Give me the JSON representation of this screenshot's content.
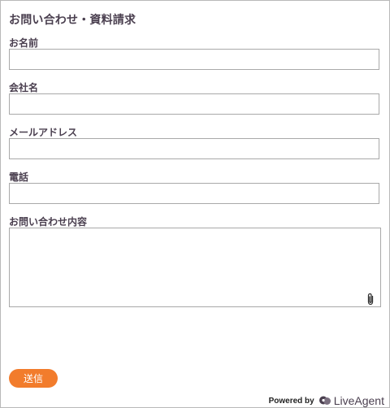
{
  "form": {
    "title": "お問い合わせ・資料請求",
    "fields": [
      {
        "label": "お名前",
        "value": ""
      },
      {
        "label": "会社名",
        "value": ""
      },
      {
        "label": "メールアドレス",
        "value": ""
      },
      {
        "label": "電話",
        "value": ""
      }
    ],
    "message": {
      "label": "お問い合わせ内容",
      "value": ""
    },
    "attach_icon": "paperclip-icon",
    "submit_label": "送信"
  },
  "footer": {
    "powered_by": "Powered by",
    "brand": "LiveAgent",
    "brand_icon": "liveagent-logo-icon"
  },
  "colors": {
    "text": "#4a3f4f",
    "accent": "#f27c2c",
    "border": "#a9a9a9"
  }
}
